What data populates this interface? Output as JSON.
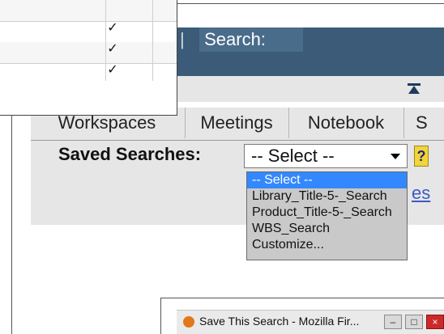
{
  "header": {
    "separator": "|",
    "search_tab": "Search:"
  },
  "tabs": [
    {
      "label": "Workspaces"
    },
    {
      "label": "Meetings"
    },
    {
      "label": "Notebook"
    },
    {
      "label": "S"
    }
  ],
  "saved_searches": {
    "label": "Saved Searches:",
    "selected_value": "-- Select --",
    "options": [
      "-- Select --",
      "Library_Title-5-_Search",
      "Product_Title-5-_Search",
      "WBS_Search",
      "Customize..."
    ],
    "help": "?",
    "partial_link": "es"
  },
  "grid": {
    "checkmarks": [
      "✓",
      "✓",
      "✓"
    ]
  },
  "popup": {
    "title": "Save This Search - Mozilla Fir...",
    "minimize": "–",
    "maximize": "□",
    "close": "×"
  }
}
